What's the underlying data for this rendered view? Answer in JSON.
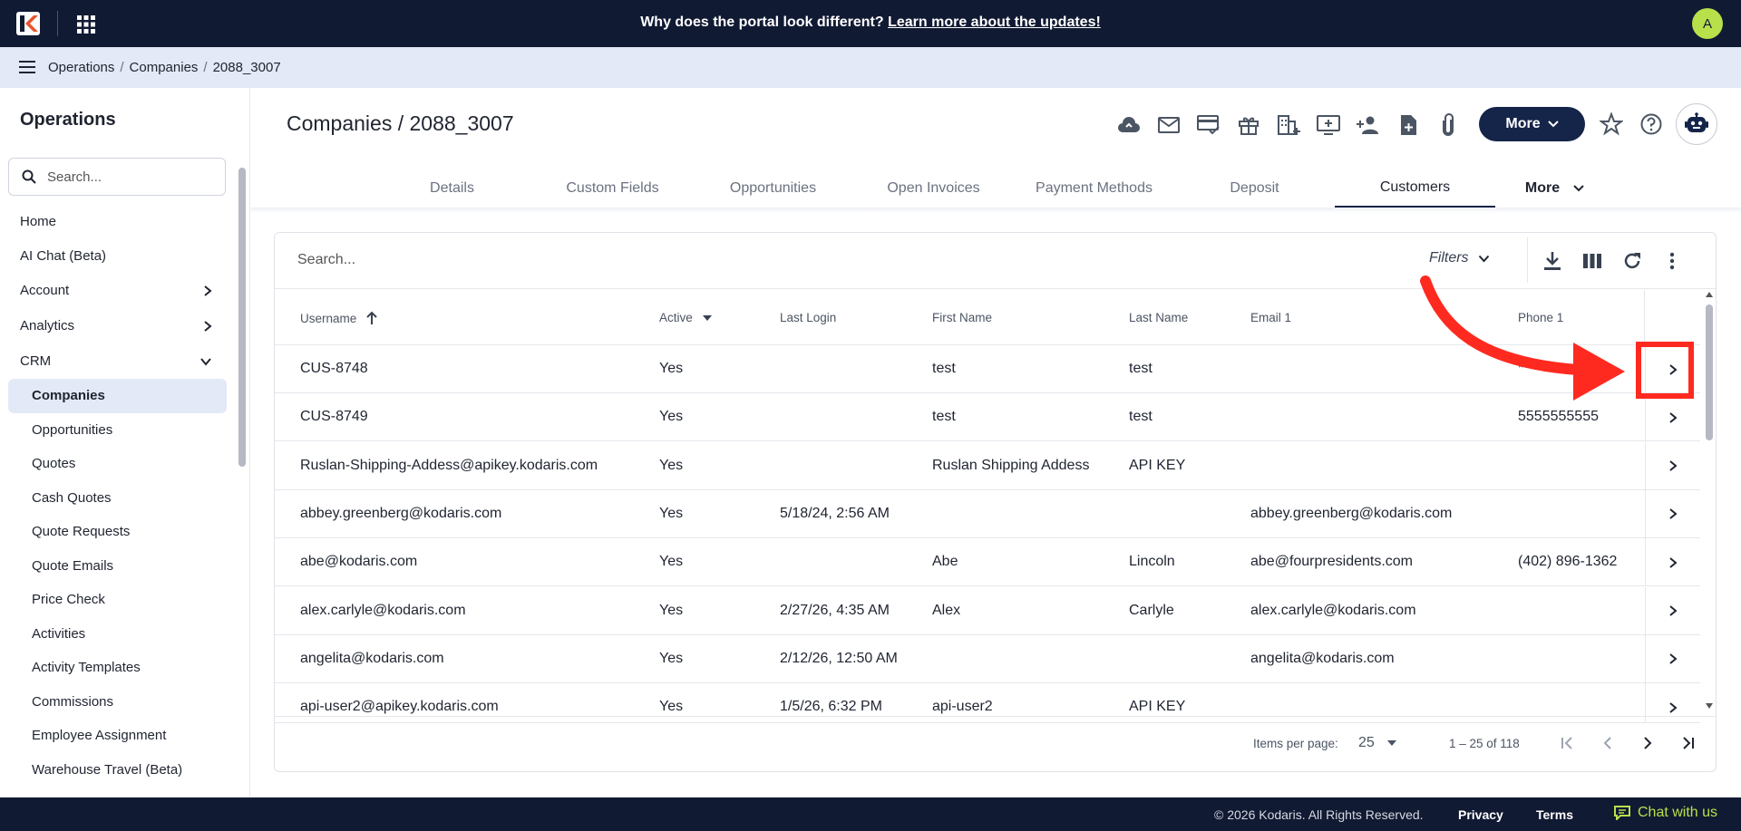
{
  "topbar": {
    "announcement_text": "Why does the portal look different?",
    "announcement_link": "Learn more about the updates!",
    "avatar_initial": "A"
  },
  "breadcrumb": {
    "items": [
      "Operations",
      "Companies",
      "2088_3007"
    ],
    "separator": "/"
  },
  "sidebar": {
    "title": "Operations",
    "search_placeholder": "Search...",
    "items": [
      {
        "label": "Home"
      },
      {
        "label": "AI Chat (Beta)"
      },
      {
        "label": "Account"
      },
      {
        "label": "Analytics"
      },
      {
        "label": "CRM"
      }
    ],
    "crm_children": [
      "Companies",
      "Opportunities",
      "Quotes",
      "Cash Quotes",
      "Quote Requests",
      "Quote Emails",
      "Price Check",
      "Activities",
      "Activity Templates",
      "Commissions",
      "Employee Assignment",
      "Warehouse Travel (Beta)"
    ]
  },
  "header": {
    "title": "Companies / 2088_3007",
    "more_label": "More",
    "toolbar_icons": [
      "cloud-upload-icon",
      "mail-icon",
      "card-check-icon",
      "gift-icon",
      "building-add-icon",
      "monitor-add-icon",
      "person-add-icon",
      "file-add-icon",
      "paperclip-icon"
    ]
  },
  "tabs": {
    "items": [
      "Details",
      "Custom Fields",
      "Opportunities",
      "Open Invoices",
      "Payment Methods",
      "Deposit",
      "Customers"
    ],
    "active": "Customers",
    "more_label": "More"
  },
  "table": {
    "search_placeholder": "Search...",
    "filters_label": "Filters",
    "columns": [
      "Username",
      "Active",
      "Last Login",
      "First Name",
      "Last Name",
      "Email 1",
      "Phone 1"
    ],
    "rows": [
      [
        "CUS-8748",
        "Yes",
        "",
        "test",
        "test",
        "",
        "*****"
      ],
      [
        "CUS-8749",
        "Yes",
        "",
        "test",
        "test",
        "",
        "5555555555"
      ],
      [
        "Ruslan-Shipping-Addess@apikey.kodaris.com",
        "Yes",
        "",
        "Ruslan Shipping Addess",
        "API KEY",
        "",
        ""
      ],
      [
        "abbey.greenberg@kodaris.com",
        "Yes",
        "5/18/24, 2:56 AM",
        "",
        "",
        "abbey.greenberg@kodaris.com",
        ""
      ],
      [
        "abe@kodaris.com",
        "Yes",
        "",
        "Abe",
        "Lincoln",
        "abe@fourpresidents.com",
        "(402) 896-1362"
      ],
      [
        "alex.carlyle@kodaris.com",
        "Yes",
        "2/27/26, 4:35 AM",
        "Alex",
        "Carlyle",
        "alex.carlyle@kodaris.com",
        ""
      ],
      [
        "angelita@kodaris.com",
        "Yes",
        "2/12/26, 12:50 AM",
        "",
        "",
        "angelita@kodaris.com",
        ""
      ],
      [
        "api-user2@apikey.kodaris.com",
        "Yes",
        "1/5/26, 6:32 PM",
        "api-user2",
        "API KEY",
        "",
        ""
      ]
    ],
    "pagination": {
      "items_per_page_label": "Items per page:",
      "items_per_page": "25",
      "range": "1 – 25 of 118"
    }
  },
  "footer": {
    "copyright": "© 2026 Kodaris. All Rights Reserved.",
    "privacy": "Privacy",
    "terms": "Terms",
    "chat": "Chat with us"
  },
  "colors": {
    "navy": "#111a33",
    "button_navy": "#152449",
    "accent_green": "#b8e04a",
    "breadcrumb_bg": "#e3e9f6",
    "annotation_red": "#ff2a1f"
  }
}
